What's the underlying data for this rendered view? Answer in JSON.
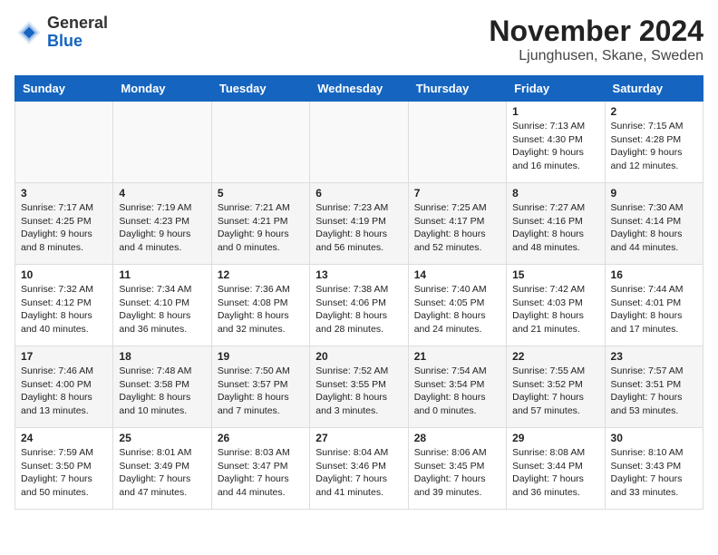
{
  "header": {
    "logo_line1": "General",
    "logo_line2": "Blue",
    "month_year": "November 2024",
    "location": "Ljunghusen, Skane, Sweden"
  },
  "days_of_week": [
    "Sunday",
    "Monday",
    "Tuesday",
    "Wednesday",
    "Thursday",
    "Friday",
    "Saturday"
  ],
  "weeks": [
    [
      {
        "day": "",
        "info": ""
      },
      {
        "day": "",
        "info": ""
      },
      {
        "day": "",
        "info": ""
      },
      {
        "day": "",
        "info": ""
      },
      {
        "day": "",
        "info": ""
      },
      {
        "day": "1",
        "info": "Sunrise: 7:13 AM\nSunset: 4:30 PM\nDaylight: 9 hours and 16 minutes."
      },
      {
        "day": "2",
        "info": "Sunrise: 7:15 AM\nSunset: 4:28 PM\nDaylight: 9 hours and 12 minutes."
      }
    ],
    [
      {
        "day": "3",
        "info": "Sunrise: 7:17 AM\nSunset: 4:25 PM\nDaylight: 9 hours and 8 minutes."
      },
      {
        "day": "4",
        "info": "Sunrise: 7:19 AM\nSunset: 4:23 PM\nDaylight: 9 hours and 4 minutes."
      },
      {
        "day": "5",
        "info": "Sunrise: 7:21 AM\nSunset: 4:21 PM\nDaylight: 9 hours and 0 minutes."
      },
      {
        "day": "6",
        "info": "Sunrise: 7:23 AM\nSunset: 4:19 PM\nDaylight: 8 hours and 56 minutes."
      },
      {
        "day": "7",
        "info": "Sunrise: 7:25 AM\nSunset: 4:17 PM\nDaylight: 8 hours and 52 minutes."
      },
      {
        "day": "8",
        "info": "Sunrise: 7:27 AM\nSunset: 4:16 PM\nDaylight: 8 hours and 48 minutes."
      },
      {
        "day": "9",
        "info": "Sunrise: 7:30 AM\nSunset: 4:14 PM\nDaylight: 8 hours and 44 minutes."
      }
    ],
    [
      {
        "day": "10",
        "info": "Sunrise: 7:32 AM\nSunset: 4:12 PM\nDaylight: 8 hours and 40 minutes."
      },
      {
        "day": "11",
        "info": "Sunrise: 7:34 AM\nSunset: 4:10 PM\nDaylight: 8 hours and 36 minutes."
      },
      {
        "day": "12",
        "info": "Sunrise: 7:36 AM\nSunset: 4:08 PM\nDaylight: 8 hours and 32 minutes."
      },
      {
        "day": "13",
        "info": "Sunrise: 7:38 AM\nSunset: 4:06 PM\nDaylight: 8 hours and 28 minutes."
      },
      {
        "day": "14",
        "info": "Sunrise: 7:40 AM\nSunset: 4:05 PM\nDaylight: 8 hours and 24 minutes."
      },
      {
        "day": "15",
        "info": "Sunrise: 7:42 AM\nSunset: 4:03 PM\nDaylight: 8 hours and 21 minutes."
      },
      {
        "day": "16",
        "info": "Sunrise: 7:44 AM\nSunset: 4:01 PM\nDaylight: 8 hours and 17 minutes."
      }
    ],
    [
      {
        "day": "17",
        "info": "Sunrise: 7:46 AM\nSunset: 4:00 PM\nDaylight: 8 hours and 13 minutes."
      },
      {
        "day": "18",
        "info": "Sunrise: 7:48 AM\nSunset: 3:58 PM\nDaylight: 8 hours and 10 minutes."
      },
      {
        "day": "19",
        "info": "Sunrise: 7:50 AM\nSunset: 3:57 PM\nDaylight: 8 hours and 7 minutes."
      },
      {
        "day": "20",
        "info": "Sunrise: 7:52 AM\nSunset: 3:55 PM\nDaylight: 8 hours and 3 minutes."
      },
      {
        "day": "21",
        "info": "Sunrise: 7:54 AM\nSunset: 3:54 PM\nDaylight: 8 hours and 0 minutes."
      },
      {
        "day": "22",
        "info": "Sunrise: 7:55 AM\nSunset: 3:52 PM\nDaylight: 7 hours and 57 minutes."
      },
      {
        "day": "23",
        "info": "Sunrise: 7:57 AM\nSunset: 3:51 PM\nDaylight: 7 hours and 53 minutes."
      }
    ],
    [
      {
        "day": "24",
        "info": "Sunrise: 7:59 AM\nSunset: 3:50 PM\nDaylight: 7 hours and 50 minutes."
      },
      {
        "day": "25",
        "info": "Sunrise: 8:01 AM\nSunset: 3:49 PM\nDaylight: 7 hours and 47 minutes."
      },
      {
        "day": "26",
        "info": "Sunrise: 8:03 AM\nSunset: 3:47 PM\nDaylight: 7 hours and 44 minutes."
      },
      {
        "day": "27",
        "info": "Sunrise: 8:04 AM\nSunset: 3:46 PM\nDaylight: 7 hours and 41 minutes."
      },
      {
        "day": "28",
        "info": "Sunrise: 8:06 AM\nSunset: 3:45 PM\nDaylight: 7 hours and 39 minutes."
      },
      {
        "day": "29",
        "info": "Sunrise: 8:08 AM\nSunset: 3:44 PM\nDaylight: 7 hours and 36 minutes."
      },
      {
        "day": "30",
        "info": "Sunrise: 8:10 AM\nSunset: 3:43 PM\nDaylight: 7 hours and 33 minutes."
      }
    ]
  ]
}
